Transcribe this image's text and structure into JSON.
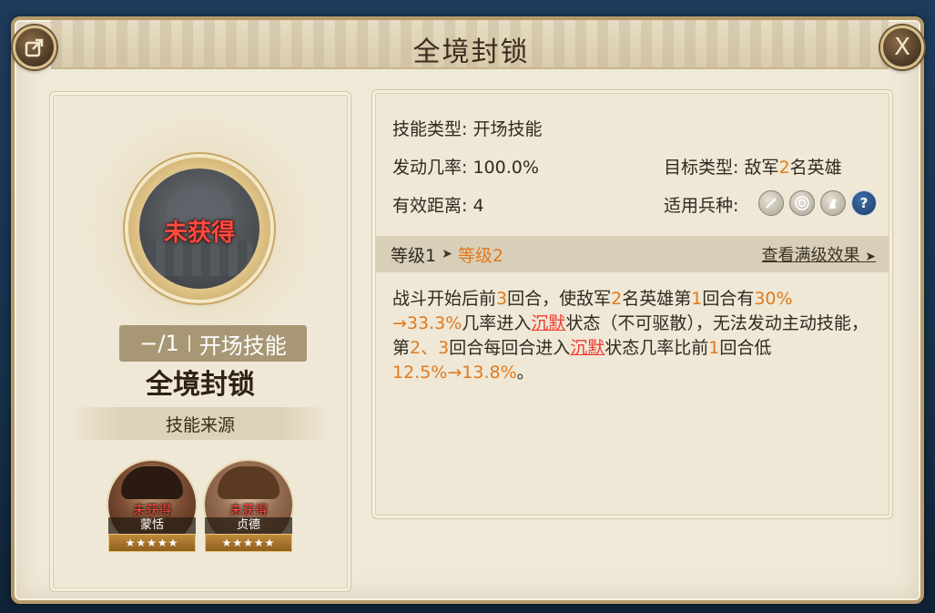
{
  "window": {
    "title": "全境封锁",
    "close_label": "X"
  },
  "skill": {
    "status": "未获得",
    "level_text": "−/1",
    "type": "开场技能",
    "name": "全境封锁",
    "source_label": "技能来源"
  },
  "heroes": [
    {
      "status": "未获得",
      "name": "蒙恬",
      "stars": "★★★★★",
      "star_count": 5
    },
    {
      "status": "未获得",
      "name": "贞德",
      "stars": "★★★★★",
      "star_count": 5
    }
  ],
  "details": {
    "type_label": "技能类型:",
    "type_value": "开场技能",
    "rate_label": "发动几率:",
    "rate_value": "100.0%",
    "range_label": "有效距离:",
    "range_value": "4",
    "target_label": "目标类型:",
    "target_pre": "敌军",
    "target_num": "2",
    "target_post": "名英雄",
    "troop_label": "适用兵种:",
    "troop_icons": [
      "sword-icon",
      "target-icon",
      "horse-icon",
      "question-icon"
    ]
  },
  "level": {
    "current": "等级1",
    "next": "等级2",
    "max_link": "查看满级效果"
  },
  "description": {
    "p1": "战斗开始后前",
    "n1": "3",
    "p2": "回合，使敌军",
    "n2": "2",
    "p3": "名英雄第",
    "n3": "1",
    "p4": "回合有",
    "n4": "30%",
    "n5": "→33.3%",
    "p5": "几率进入",
    "k1": "沉默",
    "p6": "状态（不可驱散），无法发动主动技能，第",
    "n6": "2、3",
    "p7": "回合每回合进入",
    "k2": "沉默",
    "p8": "状态几率比前",
    "n7": "1",
    "p9": "回合低",
    "n8": "12.5%",
    "n9": "→13.8%",
    "p10": "。"
  },
  "colors": {
    "accent_orange": "#e07a1e",
    "status_red": "#f03b32",
    "frame_gold": "#b59a6a"
  }
}
